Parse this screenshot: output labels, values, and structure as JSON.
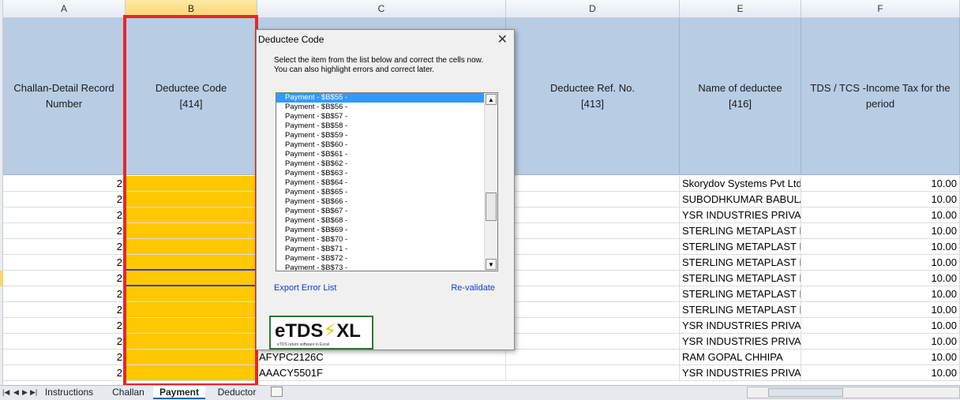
{
  "columns": [
    "A",
    "B",
    "C",
    "D",
    "E",
    "F"
  ],
  "headers": {
    "a": "Challan-Detail Record Number",
    "b1": "Deductee Code",
    "b2": "[414]",
    "d1": "Deductee Ref. No.",
    "d2": "[413]",
    "e1": "Name of deductee",
    "e2": "[416]",
    "f": "TDS / TCS -Income Tax for the period"
  },
  "rows": [
    {
      "a": "2",
      "c": "",
      "e": "Skorydov Systems Pvt Ltd",
      "f": "10.00"
    },
    {
      "a": "2",
      "c": "",
      "e": "SUBODHKUMAR BABULAL",
      "f": "10.00"
    },
    {
      "a": "2",
      "c": "",
      "e": "YSR INDUSTRIES PRIVATE",
      "f": "10.00"
    },
    {
      "a": "2",
      "c": "",
      "e": "STERLING METAPLAST IN",
      "f": "10.00"
    },
    {
      "a": "2",
      "c": "",
      "e": "STERLING METAPLAST IN",
      "f": "10.00"
    },
    {
      "a": "2",
      "c": "",
      "e": "STERLING METAPLAST IN",
      "f": "10.00"
    },
    {
      "a": "2",
      "c": "",
      "e": "STERLING METAPLAST IN",
      "f": "10.00"
    },
    {
      "a": "2",
      "c": "",
      "e": "STERLING METAPLAST IN",
      "f": "10.00"
    },
    {
      "a": "2",
      "c": "",
      "e": "STERLING METAPLAST IN",
      "f": "10.00"
    },
    {
      "a": "2",
      "c": "",
      "e": "YSR INDUSTRIES PRIVATE",
      "f": "10.00"
    },
    {
      "a": "2",
      "c": "",
      "e": "YSR INDUSTRIES PRIVATE",
      "f": "10.00"
    },
    {
      "a": "2",
      "c": "AFYPC2126C",
      "e": "RAM GOPAL CHHIPA",
      "f": "10.00"
    },
    {
      "a": "2",
      "c": "AAACY5501F",
      "e": "YSR INDUSTRIES PRIVATE",
      "f": "10.00"
    }
  ],
  "dialog": {
    "title": "Deductee Code",
    "close": "✕",
    "message_line1": "Select the item from the list below and correct the cells now.",
    "message_line2": "You can also highlight errors and correct later.",
    "items": [
      "Payment - $B$55 -",
      "Payment - $B$56 -",
      "Payment - $B$57 -",
      "Payment - $B$58 -",
      "Payment - $B$59 -",
      "Payment - $B$60 -",
      "Payment - $B$61 -",
      "Payment - $B$62 -",
      "Payment - $B$63 -",
      "Payment - $B$64 -",
      "Payment - $B$65 -",
      "Payment - $B$66 -",
      "Payment - $B$67 -",
      "Payment - $B$68 -",
      "Payment - $B$69 -",
      "Payment - $B$70 -",
      "Payment - $B$71 -",
      "Payment - $B$72 -",
      "Payment - $B$73 -"
    ],
    "selected_index": 0,
    "export_link": "Export Error List",
    "revalidate_link": "Re-validate",
    "logo_text": "eTDS",
    "logo_text2": "XL",
    "logo_tagline": "eTDS return software in Excel"
  },
  "tabs": [
    "Instructions",
    "Challan",
    "Payment",
    "Deductor"
  ],
  "active_tab": "Payment",
  "colors": {
    "header_fill": "#b8cce4",
    "highlight": "#ffc800",
    "selection_border": "#e8262a",
    "list_selected": "#3399ff"
  }
}
